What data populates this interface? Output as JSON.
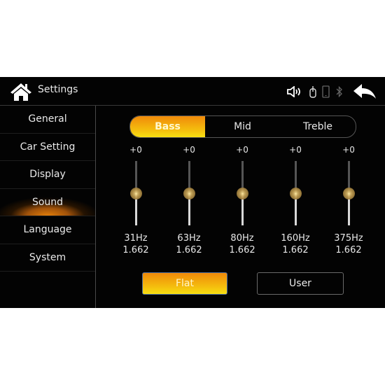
{
  "header": {
    "title": "Settings",
    "icons": [
      "home-icon",
      "speaker-icon",
      "usb-icon",
      "phone-icon",
      "bluetooth-icon",
      "back-arrow-icon"
    ]
  },
  "sidebar": {
    "items": [
      {
        "label": "General",
        "active": false
      },
      {
        "label": "Car Setting",
        "active": false
      },
      {
        "label": "Display",
        "active": false
      },
      {
        "label": "Sound",
        "active": true
      },
      {
        "label": "Language",
        "active": false
      },
      {
        "label": "System",
        "active": false
      }
    ]
  },
  "tabs": [
    {
      "label": "Bass",
      "active": true
    },
    {
      "label": "Mid",
      "active": false
    },
    {
      "label": "Treble",
      "active": false
    }
  ],
  "equalizer": {
    "bands": [
      {
        "gain": "+0",
        "frequency": "31Hz",
        "q": "1.662",
        "level": 0
      },
      {
        "gain": "+0",
        "frequency": "63Hz",
        "q": "1.662",
        "level": 0
      },
      {
        "gain": "+0",
        "frequency": "80Hz",
        "q": "1.662",
        "level": 0
      },
      {
        "gain": "+0",
        "frequency": "160Hz",
        "q": "1.662",
        "level": 0
      },
      {
        "gain": "+0",
        "frequency": "375Hz",
        "q": "1.662",
        "level": 0
      }
    ]
  },
  "presets": {
    "flat_label": "Flat",
    "user_label": "User",
    "selected": "Flat"
  },
  "colors": {
    "accent_top": "#f08a0a",
    "accent_bottom": "#f7e012",
    "background": "#030303"
  }
}
